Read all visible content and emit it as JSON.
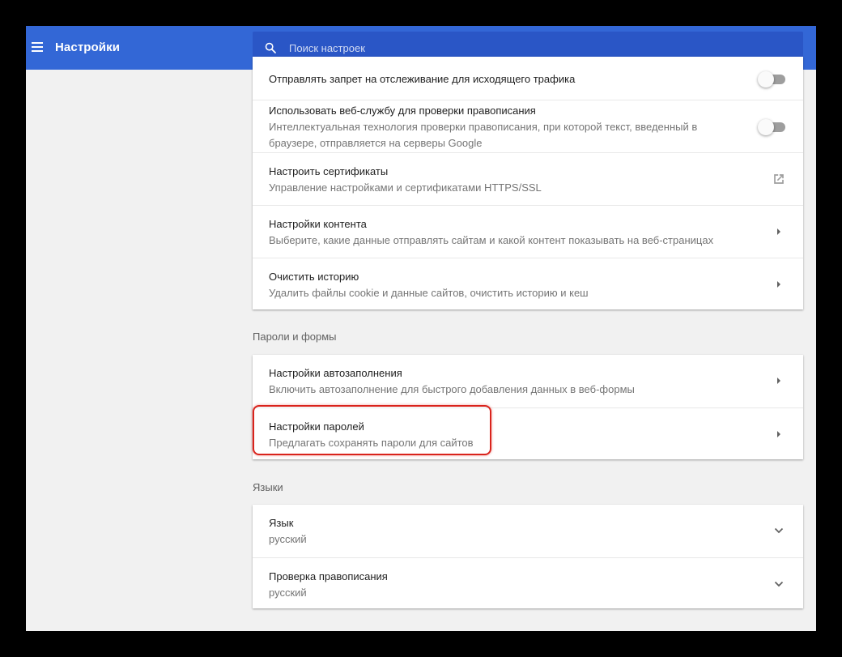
{
  "toolbar": {
    "menu_icon": "hamburger-menu-icon",
    "title": "Настройки",
    "search": {
      "icon": "search-icon",
      "placeholder": "Поиск настроек",
      "value": ""
    }
  },
  "colors": {
    "toolbar": "#3367d6",
    "search_bg": "#2a56c6",
    "page_bg": "#f1f1f1",
    "highlight": "#d9231c"
  },
  "privacy": {
    "items": [
      {
        "title": "Отправлять запрет на отслеживание для исходящего трафика",
        "control": "toggle",
        "checked": false
      },
      {
        "title": "Использовать веб-службу для проверки правописания",
        "subtitle": "Интеллектуальная технология проверки правописания, при которой текст, введенный в браузере, отправляется на серверы Google",
        "control": "toggle",
        "checked": false
      },
      {
        "title": "Настроить сертификаты",
        "subtitle": "Управление настройками и сертификатами HTTPS/SSL",
        "control": "open-in-new-icon"
      },
      {
        "title": "Настройки контента",
        "subtitle": "Выберите, какие данные отправлять сайтам и какой контент показывать на веб-страницах",
        "control": "chevron-right-icon"
      },
      {
        "title": "Очистить историю",
        "subtitle": "Удалить файлы cookie и данные сайтов, очистить историю и кеш",
        "control": "chevron-right-icon"
      }
    ]
  },
  "passwords": {
    "heading": "Пароли и формы",
    "items": [
      {
        "title": "Настройки автозаполнения",
        "subtitle": "Включить автозаполнение для быстрого добавления данных в веб-формы",
        "control": "chevron-right-icon"
      },
      {
        "title": "Настройки паролей",
        "subtitle": "Предлагать сохранять пароли для сайтов",
        "control": "chevron-right-icon",
        "highlighted": true
      }
    ]
  },
  "languages": {
    "heading": "Языки",
    "items": [
      {
        "title": "Язык",
        "subtitle": "русский",
        "control": "chevron-down-icon"
      },
      {
        "title": "Проверка правописания",
        "subtitle": "русский",
        "control": "chevron-down-icon"
      }
    ]
  }
}
